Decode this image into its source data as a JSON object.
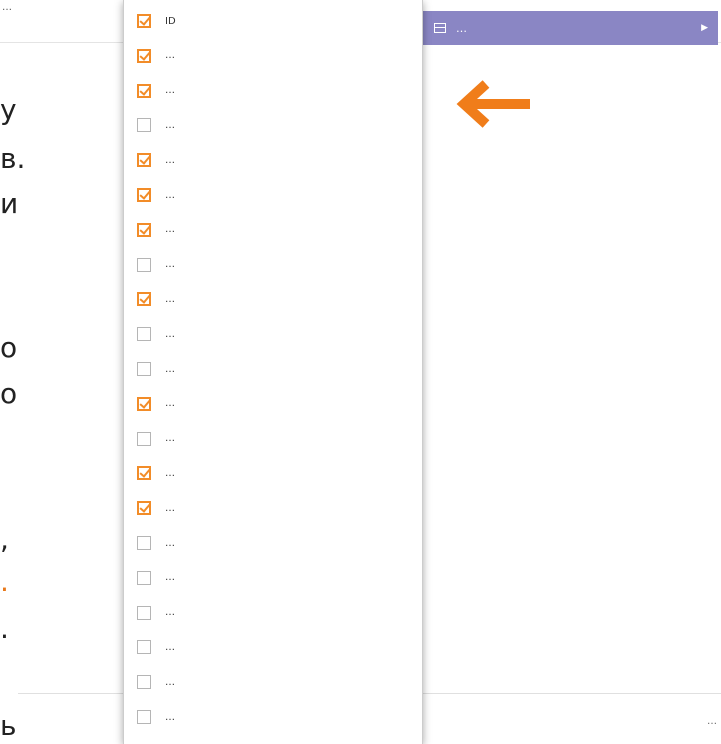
{
  "background": {
    "top_left_text": "…",
    "top_mid_text": "…",
    "side_letters": [
      "у",
      "в.",
      "и",
      "о",
      "о",
      ",",
      ".",
      ".",
      "ь"
    ],
    "footer_text": "…"
  },
  "columns_button": {
    "label": "…"
  },
  "colors": {
    "accent": "#f28c28",
    "button_bg": "#8a86c4",
    "arrow": "#f07d1a"
  },
  "column_options": [
    {
      "label": "ID",
      "checked": true
    },
    {
      "label": "…",
      "checked": true
    },
    {
      "label": "…",
      "checked": true
    },
    {
      "label": "…",
      "checked": false
    },
    {
      "label": "…",
      "checked": true
    },
    {
      "label": "…",
      "checked": true
    },
    {
      "label": "…",
      "checked": true
    },
    {
      "label": "…",
      "checked": false
    },
    {
      "label": "…",
      "checked": true
    },
    {
      "label": "…",
      "checked": false
    },
    {
      "label": "…",
      "checked": false
    },
    {
      "label": "…",
      "checked": true
    },
    {
      "label": "…",
      "checked": false
    },
    {
      "label": "…",
      "checked": true
    },
    {
      "label": "…",
      "checked": true
    },
    {
      "label": "…",
      "checked": false
    },
    {
      "label": "…",
      "checked": false
    },
    {
      "label": "…",
      "checked": false
    },
    {
      "label": "…",
      "checked": false
    },
    {
      "label": "…",
      "checked": false
    },
    {
      "label": "…",
      "checked": false
    }
  ]
}
